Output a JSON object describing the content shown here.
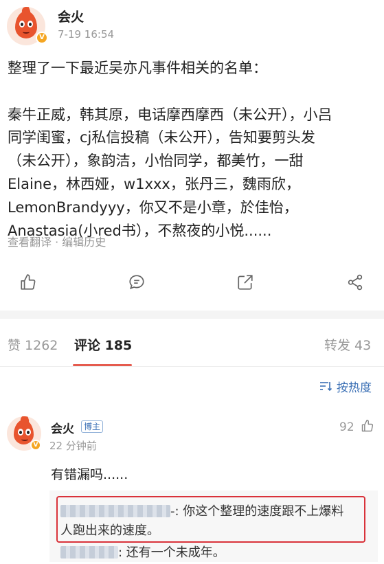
{
  "post": {
    "author": "会火",
    "time": "7-19 16:54",
    "content": [
      "整理了一下最近吴亦凡事件相关的名单：",
      "",
      "秦牛正威，韩其原，电话摩西摩西（未公开），小吕",
      "同学闺蜜，cj私信投稿（未公开），告知要剪头发",
      "（未公开），象韵洁，小怡同学，都美竹，一甜",
      "Elaine，林西娅，w1xxx，张丹三，魏雨欣，",
      "LemonBrandyyy，你又不是小章，於佳怡，",
      "Anastasia(小red书），不熬夜的小悦......"
    ],
    "meta": "查看翻译 · 编辑历史",
    "actions": [
      "like-icon",
      "comment-icon",
      "repost-icon",
      "share-icon"
    ]
  },
  "tabs": {
    "likes": "赞 1262",
    "comments": "评论 185",
    "reposts": "转发 43"
  },
  "sort": {
    "label": "按热度",
    "icon": "sort-icon"
  },
  "comment": {
    "author": "会火",
    "badge": "博主",
    "time": "22 分钟前",
    "likes": "92",
    "text": "有错漏吗......",
    "replies": [
      {
        "suffix_line1": "-: 你这个整理的速度跟不上爆料",
        "line2": "人跑出来的速度。"
      },
      {
        "suffix": ": 还有一个未成年。"
      }
    ]
  },
  "colors": {
    "accent_red": "#e55b4e",
    "link_blue": "#3b70b5",
    "highlight_border": "#d9323a",
    "badge_gold": "#f5a623"
  }
}
